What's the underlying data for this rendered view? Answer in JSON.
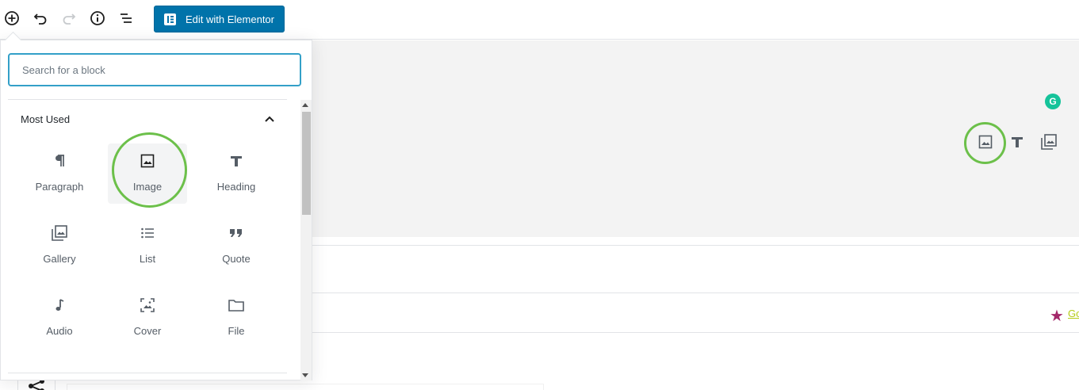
{
  "toolbar": {
    "add_block_icon": "plus-circle-icon",
    "undo_icon": "undo-icon",
    "redo_icon": "redo-icon",
    "info_icon": "info-icon",
    "outline_icon": "list-outline-icon",
    "elementor_label": "Edit with Elementor"
  },
  "inserter": {
    "search_placeholder": "Search for a block",
    "section_title": "Most Used",
    "blocks": [
      {
        "label": "Paragraph",
        "icon": "paragraph-icon"
      },
      {
        "label": "Image",
        "icon": "image-icon"
      },
      {
        "label": "Heading",
        "icon": "heading-icon"
      },
      {
        "label": "Gallery",
        "icon": "gallery-icon"
      },
      {
        "label": "List",
        "icon": "list-icon"
      },
      {
        "label": "Quote",
        "icon": "quote-icon"
      },
      {
        "label": "Audio",
        "icon": "audio-icon"
      },
      {
        "label": "Cover",
        "icon": "cover-icon"
      },
      {
        "label": "File",
        "icon": "file-icon"
      }
    ]
  },
  "canvas": {
    "grammarly_letter": "G",
    "link_text": "Go"
  },
  "colors": {
    "accent": "#0073aa",
    "highlight_circle": "#6cc04a",
    "grammarly": "#15c39a",
    "star": "#a4286a"
  }
}
